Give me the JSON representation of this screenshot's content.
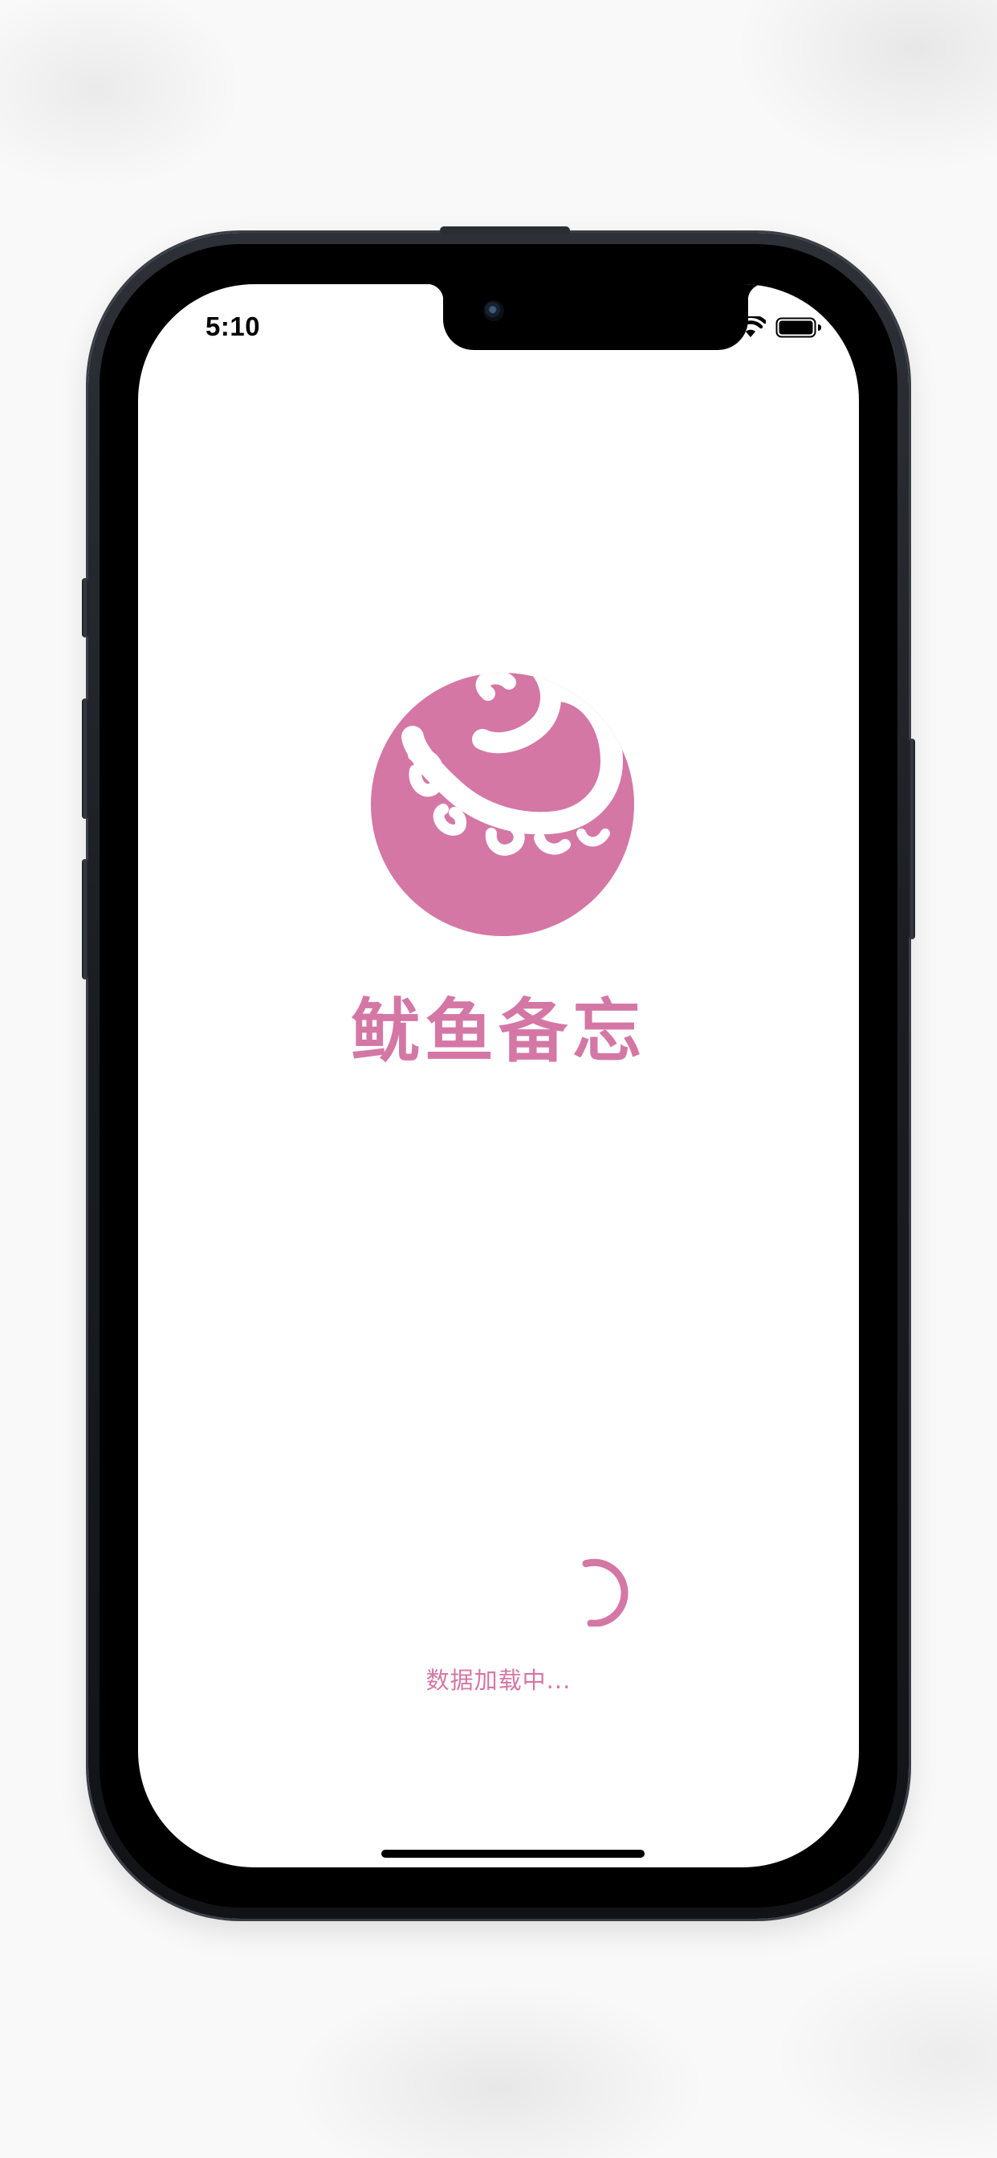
{
  "status_bar": {
    "time": "5:10",
    "wifi_icon": "wifi-icon",
    "battery_icon": "battery-icon"
  },
  "splash": {
    "logo_icon": "squid-logo-icon",
    "app_name": "鱿鱼备忘",
    "loading_text": "数据加载中..."
  },
  "colors": {
    "accent": "#d477a5",
    "text_dark": "#000000",
    "screen_bg": "#ffffff"
  }
}
